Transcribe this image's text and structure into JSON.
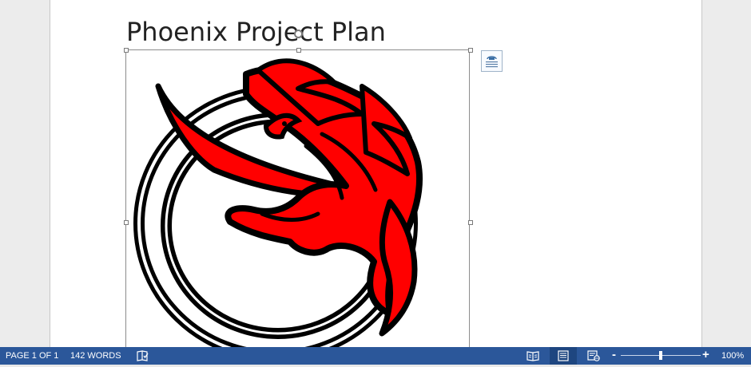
{
  "document": {
    "title": "Phoenix Project Plan"
  },
  "status_bar": {
    "page_info": "PAGE 1 OF 1",
    "word_count": "142 WORDS",
    "zoom_level": "100%",
    "zoom_minus": "-",
    "zoom_plus": "+",
    "zoom_value_percent": 100
  },
  "colors": {
    "status_bar": "#2b579a",
    "phoenix_red": "#ff0000",
    "ring_black": "#000000"
  },
  "icons": {
    "layout_options": "layout-options-icon",
    "proofing": "proofing-book-icon",
    "read_mode": "read-mode-icon",
    "print_layout": "print-layout-icon",
    "web_layout": "web-layout-icon"
  }
}
